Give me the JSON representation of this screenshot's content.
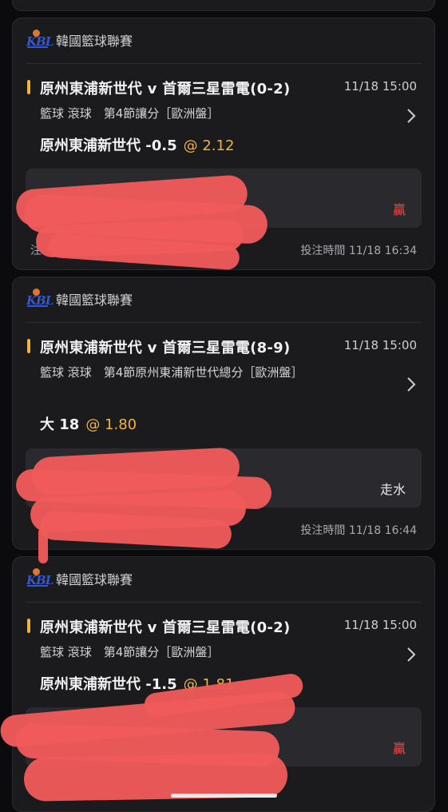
{
  "cards": [
    {
      "league": "韓國籃球聯賽",
      "match": "原州東浦新世代 v 首爾三星雷電(0-2)",
      "time": "11/18 15:00",
      "market": "籃球 滾球　第4節讓分［歐洲盤］",
      "selection": "原州東浦新世代 -0.5",
      "odds": "@ 2.12",
      "result": "贏",
      "placed_left": "注",
      "placed": "投注時間 11/18 16:34"
    },
    {
      "league": "韓國籃球聯賽",
      "match": "原州東浦新世代 v 首爾三星雷電(8-9)",
      "time": "11/18 15:00",
      "market": "籃球 滾球　第4節原州東浦新世代總分［歐洲盤］",
      "selection": "大 18",
      "odds": "@ 1.80",
      "result": "走水",
      "placed": "投注時間 11/18 16:44"
    },
    {
      "league": "韓國籃球聯賽",
      "match": "原州東浦新世代 v 首爾三星雷電(0-2)",
      "time": "11/18 15:00",
      "market": "籃球 滾球　第4節讓分［歐洲盤］",
      "selection": "原州東浦新世代 -1.5",
      "odds": "@ 1.81",
      "result": "贏"
    }
  ],
  "logo_text": "KBL",
  "colors": {
    "accent": "#f0b43c",
    "win": "#e84a4a",
    "card_bg": "#1b1b1e",
    "redaction": "#ef5a5a"
  },
  "icons": {
    "chevron": "chevron-right-icon",
    "league_logo": "kbl-logo"
  }
}
